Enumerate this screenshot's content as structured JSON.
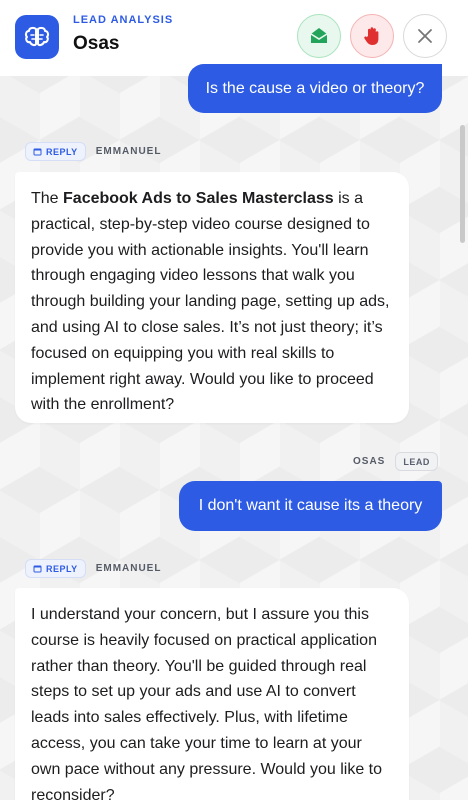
{
  "header": {
    "kicker": "LEAD ANALYSIS",
    "title": "Osas",
    "logo_icon": "brain-icon",
    "actions": [
      {
        "name": "mark-read-button",
        "icon": "envelope-open-icon",
        "color": "#22a55b"
      },
      {
        "name": "stop-button",
        "icon": "raised-hand-icon",
        "color": "#e03131"
      },
      {
        "name": "close-button",
        "icon": "close-icon",
        "color": "#777777"
      }
    ]
  },
  "colors": {
    "accent": "#2d5be3",
    "user_bubble": "#2d5be3",
    "reply_bubble": "#ffffff"
  },
  "messages": [
    {
      "role": "lead",
      "text": "Is the cause a video or theory?"
    },
    {
      "role": "reply",
      "badge": "REPLY",
      "sender": "EMMANUEL",
      "text_prefix": "The ",
      "text_bold": "Facebook Ads to Sales Masterclass",
      "text_suffix": " is a practical, step-by-step video course designed to provide you with actionable insights. You'll learn through engaging video lessons that walk you through building your landing page, setting up ads, and using AI to close sales. It’s not just theory; it’s focused on equipping you with real skills to implement right away. Would you like to proceed with the enrollment?"
    },
    {
      "role": "lead",
      "sender": "OSAS",
      "badge": "LEAD",
      "text": "I don't want it cause its a theory"
    },
    {
      "role": "reply",
      "badge": "REPLY",
      "sender": "EMMANUEL",
      "text": "I understand your concern, but I assure you this course is heavily focused on practical application rather than theory. You'll be guided through real steps to set up your ads and use AI to convert leads into sales effectively. Plus, with lifetime access, you can take your time to learn at your own pace without any pressure. Would you like to reconsider?"
    }
  ]
}
